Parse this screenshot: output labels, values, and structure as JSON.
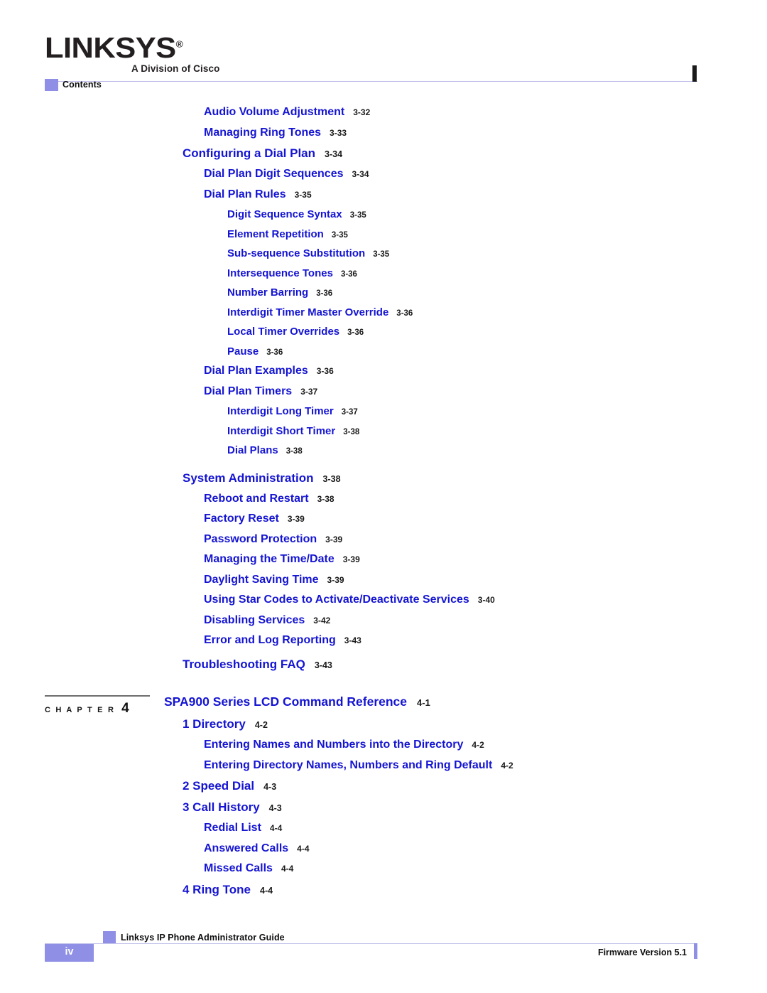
{
  "logo": {
    "wordmark": "LINKSYS",
    "registered": "®",
    "tagline": "A Division of Cisco"
  },
  "header": {
    "running_head": "Contents",
    "marker_color": "#8f8fe6",
    "rule_color": "#b9b9e8"
  },
  "colors": {
    "toc_title": "#1414d2",
    "page_number": "#1a1a1a",
    "accent_purple": "#8f8fe6"
  },
  "chapter_block": {
    "label": "C H A P T E R",
    "number": "4"
  },
  "toc": {
    "entries": [
      {
        "level": 2,
        "title": "Audio Volume Adjustment",
        "page": "3-32"
      },
      {
        "level": 2,
        "title": "Managing Ring Tones",
        "page": "3-33"
      },
      {
        "level": 1,
        "title": "Configuring a Dial Plan",
        "page": "3-34"
      },
      {
        "level": 2,
        "title": "Dial Plan Digit Sequences",
        "page": "3-34"
      },
      {
        "level": 2,
        "title": "Dial Plan Rules",
        "page": "3-35"
      },
      {
        "level": 3,
        "title": "Digit Sequence Syntax",
        "page": "3-35"
      },
      {
        "level": 3,
        "title": "Element Repetition",
        "page": "3-35"
      },
      {
        "level": 3,
        "title": "Sub-sequence Substitution",
        "page": "3-35"
      },
      {
        "level": 3,
        "title": "Intersequence Tones",
        "page": "3-36"
      },
      {
        "level": 3,
        "title": "Number Barring",
        "page": "3-36"
      },
      {
        "level": 3,
        "title": "Interdigit Timer Master Override",
        "page": "3-36"
      },
      {
        "level": 3,
        "title": "Local Timer Overrides",
        "page": "3-36"
      },
      {
        "level": 3,
        "title": "Pause",
        "page": "3-36"
      },
      {
        "level": 2,
        "title": "Dial Plan Examples",
        "page": "3-36"
      },
      {
        "level": 2,
        "title": "Dial Plan Timers",
        "page": "3-37"
      },
      {
        "level": 3,
        "title": "Interdigit Long Timer",
        "page": "3-37"
      },
      {
        "level": 3,
        "title": "Interdigit Short Timer",
        "page": "3-38"
      },
      {
        "level": 3,
        "title": "Dial Plans",
        "page": "3-38"
      },
      {
        "level": 1,
        "title": "System Administration",
        "page": "3-38",
        "gap": "big"
      },
      {
        "level": 2,
        "title": "Reboot and Restart",
        "page": "3-38"
      },
      {
        "level": 2,
        "title": "Factory Reset",
        "page": "3-39"
      },
      {
        "level": 2,
        "title": "Password Protection",
        "page": "3-39"
      },
      {
        "level": 2,
        "title": "Managing the Time/Date",
        "page": "3-39"
      },
      {
        "level": 2,
        "title": "Daylight Saving Time",
        "page": "3-39"
      },
      {
        "level": 2,
        "title": "Using Star Codes to Activate/Deactivate Services",
        "page": "3-40"
      },
      {
        "level": 2,
        "title": "Disabling Services",
        "page": "3-42"
      },
      {
        "level": 2,
        "title": "Error and Log Reporting",
        "page": "3-43"
      },
      {
        "level": 1,
        "title": "Troubleshooting FAQ",
        "page": "3-43",
        "gap": "small"
      },
      {
        "level": 0,
        "title": "SPA900 Series LCD Command Reference",
        "page": "4-1",
        "gap": "chapter"
      },
      {
        "level": 1,
        "title": "1 Directory",
        "page": "4-2"
      },
      {
        "level": 2,
        "title": "Entering Names and Numbers into the Directory",
        "page": "4-2"
      },
      {
        "level": 2,
        "title": "Entering Directory Names, Numbers and Ring Default",
        "page": "4-2"
      },
      {
        "level": 1,
        "title": "2 Speed Dial",
        "page": "4-3"
      },
      {
        "level": 1,
        "title": "3 Call History",
        "page": "4-3"
      },
      {
        "level": 2,
        "title": "Redial List",
        "page": "4-4"
      },
      {
        "level": 2,
        "title": "Answered Calls",
        "page": "4-4"
      },
      {
        "level": 2,
        "title": "Missed Calls",
        "page": "4-4"
      },
      {
        "level": 1,
        "title": "4 Ring Tone",
        "page": "4-4"
      }
    ]
  },
  "footer": {
    "guide_title": "Linksys IP Phone Administrator Guide",
    "page_number": "iv",
    "firmware": "Firmware Version 5.1"
  }
}
